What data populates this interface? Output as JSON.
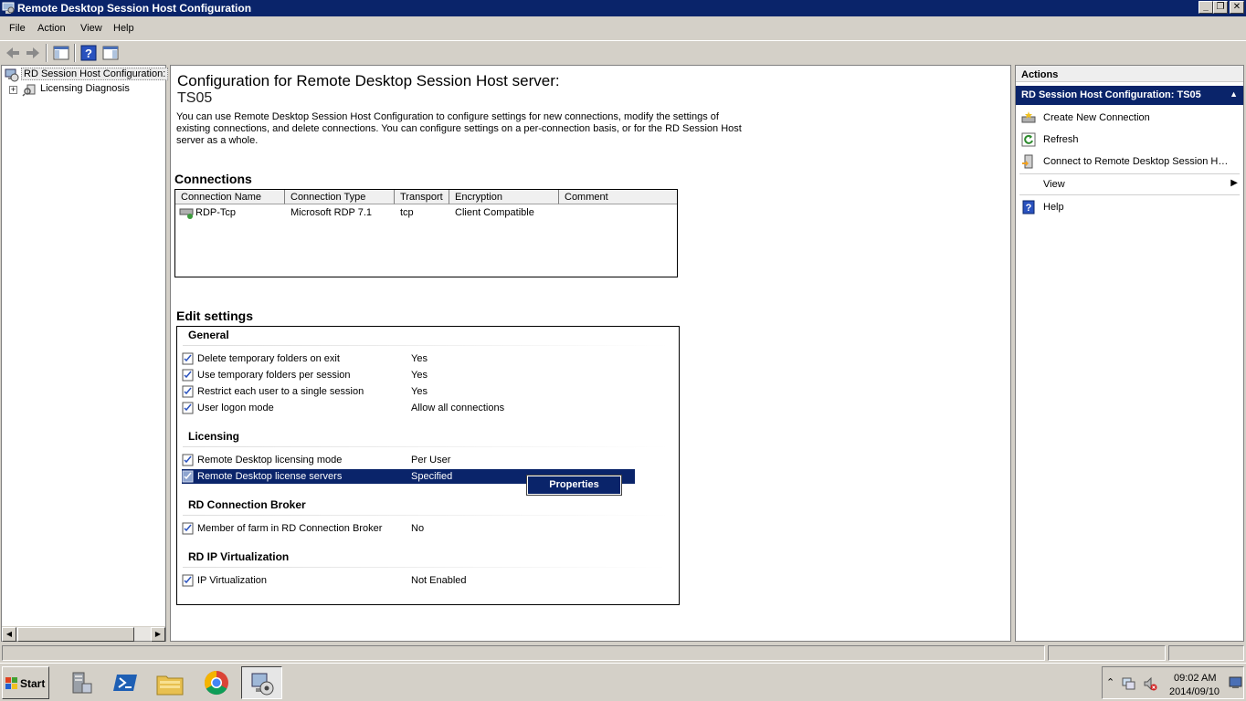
{
  "window": {
    "title": "Remote Desktop Session Host Configuration",
    "minimize_glyph": "_",
    "restore_glyph": "❐",
    "close_glyph": "✕"
  },
  "menu": [
    "File",
    "Action",
    "View",
    "Help"
  ],
  "toolbar": {
    "buttons": [
      "back-icon",
      "forward-icon",
      "show-hide-console-tree-icon",
      "help-icon",
      "show-hide-action-pane-icon"
    ]
  },
  "tree": {
    "root_label": "RD Session Host Configuration:",
    "child_label": "Licensing Diagnosis",
    "expander_glyph": "+",
    "scroll_left": "◀",
    "scroll_right": "▶"
  },
  "content": {
    "heading": "Configuration for Remote Desktop Session Host server:",
    "server_name": "TS05",
    "description": "You can use Remote Desktop Session Host Configuration to configure settings for new connections, modify the settings of existing connections, and delete connections. You can configure settings on a per-connection basis, or for the RD Session Host server as a whole.",
    "connections_title": "Connections",
    "connections": {
      "columns": [
        "Connection Name",
        "Connection Type",
        "Transport",
        "Encryption",
        "Comment"
      ],
      "rows": [
        [
          "RDP-Tcp",
          "Microsoft RDP 7.1",
          "tcp",
          "Client Compatible",
          ""
        ]
      ]
    },
    "edit_settings_title": "Edit settings",
    "groups": [
      {
        "title": "General",
        "settings": [
          {
            "label": "Delete temporary folders on exit",
            "value": "Yes"
          },
          {
            "label": "Use temporary folders per session",
            "value": "Yes"
          },
          {
            "label": "Restrict each user to a single session",
            "value": "Yes"
          },
          {
            "label": "User logon mode",
            "value": "Allow all connections"
          }
        ]
      },
      {
        "title": "Licensing",
        "settings": [
          {
            "label": "Remote Desktop licensing mode",
            "value": "Per User"
          },
          {
            "label": "Remote Desktop license servers",
            "value": "Specified",
            "selected": true
          }
        ]
      },
      {
        "title": "RD Connection Broker",
        "settings": [
          {
            "label": "Member of farm in RD Connection Broker",
            "value": "No"
          }
        ]
      },
      {
        "title": "RD IP Virtualization",
        "settings": [
          {
            "label": "IP Virtualization",
            "value": "Not Enabled"
          }
        ]
      }
    ],
    "context_menu": {
      "item": "Properties"
    }
  },
  "actions": {
    "header": "Actions",
    "subheader": "RD Session Host Configuration: TS05",
    "collapse_glyph": "▲",
    "items": [
      {
        "label": "Create New Connection",
        "icon": "create-connection-icon"
      },
      {
        "label": "Refresh",
        "icon": "refresh-icon"
      },
      {
        "label": "Connect to Remote Desktop Session H…",
        "icon": "connect-server-icon"
      },
      {
        "label": "View",
        "icon": "",
        "submenu_glyph": "▶"
      },
      {
        "label": "Help",
        "icon": "help-icon"
      }
    ]
  },
  "taskbar": {
    "start_label": "Start",
    "apps": [
      "server-manager-icon",
      "powershell-icon",
      "file-explorer-icon",
      "chrome-icon",
      "rd-session-host-config-icon"
    ],
    "clock_time": "09:02 AM",
    "clock_date": "2014/09/10",
    "tray_expand_glyph": "⌃"
  },
  "colors": {
    "titlebar": "#0a246a",
    "selection": "#0a246a",
    "chrome": "#d4d0c8"
  }
}
